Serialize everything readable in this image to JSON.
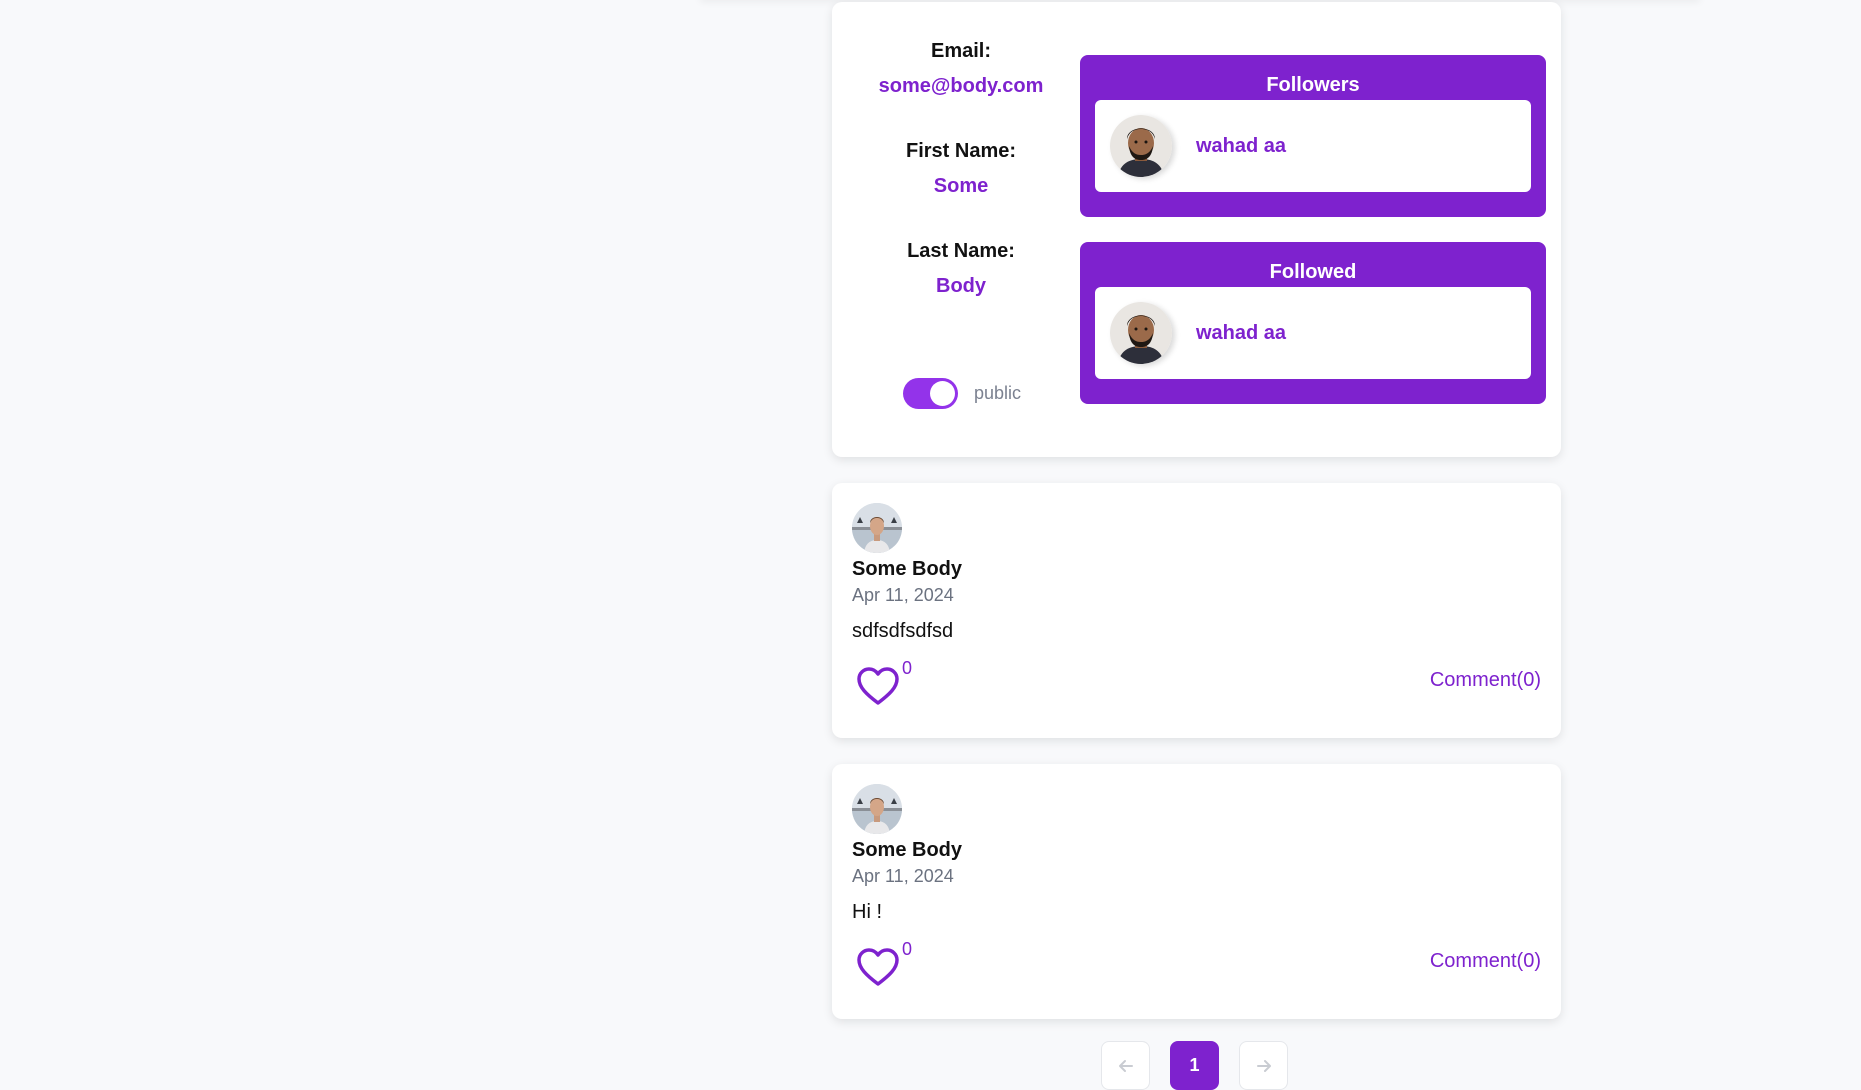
{
  "profile": {
    "email_label": "Email:",
    "email_value": "some@body.com",
    "first_name_label": "First Name:",
    "first_name_value": "Some",
    "last_name_label": "Last Name:",
    "last_name_value": "Body",
    "visibility_label": "public",
    "visibility_on": true
  },
  "followers": {
    "title": "Followers",
    "users": [
      {
        "name": "wahad aa"
      }
    ]
  },
  "followed": {
    "title": "Followed",
    "users": [
      {
        "name": "wahad aa"
      }
    ]
  },
  "posts": [
    {
      "author": "Some Body",
      "date": "Apr 11, 2024",
      "text": "sdfsdfsdfsd",
      "likes": "0",
      "comment_label": "Comment(0)"
    },
    {
      "author": "Some Body",
      "date": "Apr 11, 2024",
      "text": "Hi !",
      "likes": "0",
      "comment_label": "Comment(0)"
    }
  ],
  "pagination": {
    "prev_icon": "arrow-left-icon",
    "current_page": "1",
    "next_icon": "arrow-right-icon"
  },
  "colors": {
    "accent": "#7e22ce",
    "toggle": "#9333ea",
    "background": "#f8f9fb"
  }
}
